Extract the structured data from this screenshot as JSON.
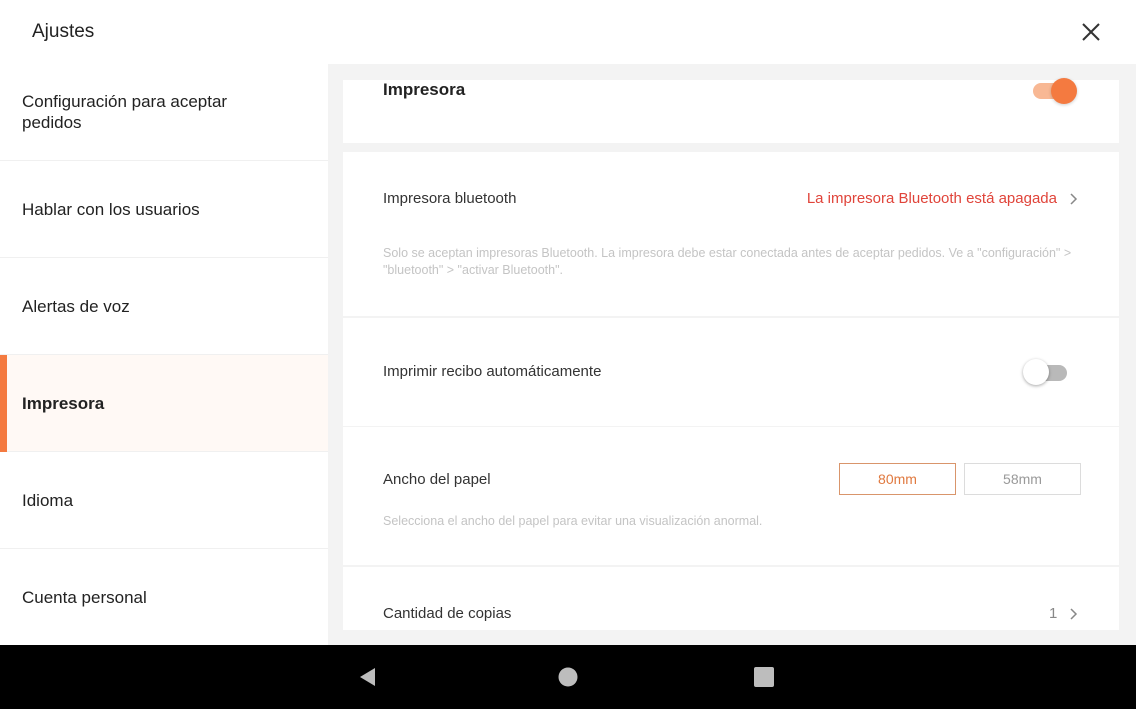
{
  "header": {
    "title": "Ajustes",
    "close_icon": "close-icon"
  },
  "sidebar": {
    "items": [
      {
        "label": "Configuración para aceptar pedidos",
        "active": false
      },
      {
        "label": "Hablar con los usuarios",
        "active": false
      },
      {
        "label": "Alertas de voz",
        "active": false
      },
      {
        "label": "Impresora",
        "active": true
      },
      {
        "label": "Idioma",
        "active": false
      },
      {
        "label": "Cuenta personal",
        "active": false
      }
    ]
  },
  "main": {
    "printer": {
      "title": "Impresora",
      "enabled": true
    },
    "bluetooth": {
      "label": "Impresora bluetooth",
      "status": "La impresora Bluetooth está apagada",
      "note": "Solo se aceptan impresoras Bluetooth. La impresora debe estar conectada antes de aceptar pedidos. Ve a \"configuración\" > \"bluetooth\" > \"activar Bluetooth\"."
    },
    "auto_print": {
      "label": "Imprimir recibo automáticamente",
      "enabled": false
    },
    "paper_width": {
      "label": "Ancho del papel",
      "options": [
        "80mm",
        "58mm"
      ],
      "selected": "80mm",
      "note": "Selecciona el ancho del papel para evitar una visualización anormal."
    },
    "copies": {
      "label": "Cantidad de copias",
      "value": "1"
    }
  },
  "navbar": {
    "icons": [
      "back-icon",
      "home-icon",
      "recents-icon"
    ]
  },
  "colors": {
    "accent": "#f47a40",
    "warning_text": "#e0443a",
    "panel_bg": "#f3f3f3"
  }
}
